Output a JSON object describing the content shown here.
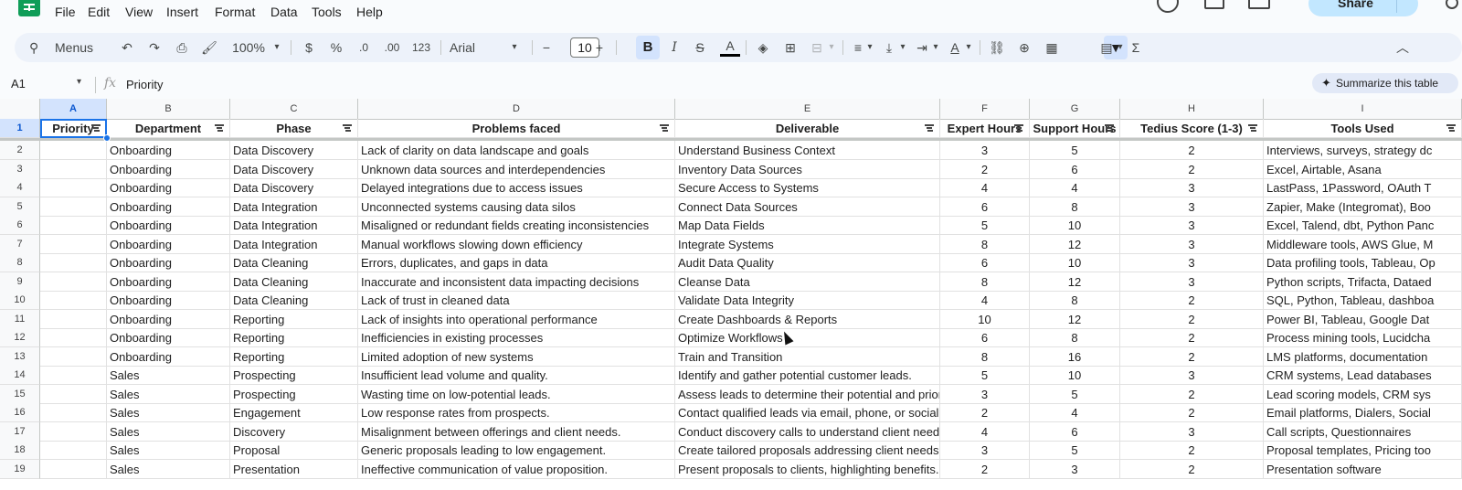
{
  "menubar": {
    "items": [
      "File",
      "Edit",
      "View",
      "Insert",
      "Format",
      "Data",
      "Tools",
      "Help"
    ],
    "share_label": "Share"
  },
  "toolbar": {
    "menus_label": "Menus",
    "zoom": "100%",
    "currency": "$",
    "percent": "%",
    "dec_decrease": ".0",
    "dec_increase": ".00",
    "number_format": "123",
    "font": "Arial",
    "font_size": "10",
    "minus": "−",
    "plus": "+",
    "bold": "B",
    "italic": "I",
    "strike": "S",
    "text_color": "A",
    "sigma": "Σ"
  },
  "formula_bar": {
    "name_box": "A1",
    "fx": "fx",
    "value": "Priority",
    "summarize_label": "Summarize this table"
  },
  "columns": [
    "A",
    "B",
    "C",
    "D",
    "E",
    "F",
    "G",
    "H",
    "I"
  ],
  "header_row": {
    "row_number": "1",
    "cells": [
      "Priority",
      "Department",
      "Phase",
      "Problems faced",
      "Deliverable",
      "Expert Hours",
      "Support Hours",
      "Tedius Score (1-3)",
      "Tools Used"
    ]
  },
  "rows": [
    {
      "n": "2",
      "cells": [
        "",
        "Onboarding",
        "Data Discovery",
        "Lack of clarity on data landscape and goals",
        "Understand Business Context",
        "3",
        "5",
        "2",
        "Interviews, surveys, strategy dc"
      ]
    },
    {
      "n": "3",
      "cells": [
        "",
        "Onboarding",
        "Data Discovery",
        "Unknown data sources and interdependencies",
        "Inventory Data Sources",
        "2",
        "6",
        "2",
        "Excel, Airtable, Asana"
      ]
    },
    {
      "n": "4",
      "cells": [
        "",
        "Onboarding",
        "Data Discovery",
        "Delayed integrations due to access issues",
        "Secure Access to Systems",
        "4",
        "4",
        "3",
        "LastPass, 1Password, OAuth T"
      ]
    },
    {
      "n": "5",
      "cells": [
        "",
        "Onboarding",
        "Data Integration",
        "Unconnected systems causing data silos",
        "Connect Data Sources",
        "6",
        "8",
        "3",
        "Zapier, Make (Integromat), Boo"
      ]
    },
    {
      "n": "6",
      "cells": [
        "",
        "Onboarding",
        "Data Integration",
        "Misaligned or redundant fields creating inconsistencies",
        "Map Data Fields",
        "5",
        "10",
        "3",
        "Excel, Talend, dbt, Python Panc"
      ]
    },
    {
      "n": "7",
      "cells": [
        "",
        "Onboarding",
        "Data Integration",
        "Manual workflows slowing down efficiency",
        "Integrate Systems",
        "8",
        "12",
        "3",
        "Middleware tools, AWS Glue, M"
      ]
    },
    {
      "n": "8",
      "cells": [
        "",
        "Onboarding",
        "Data Cleaning",
        "Errors, duplicates, and gaps in data",
        "Audit Data Quality",
        "6",
        "10",
        "3",
        "Data profiling tools, Tableau, Op"
      ]
    },
    {
      "n": "9",
      "cells": [
        "",
        "Onboarding",
        "Data Cleaning",
        "Inaccurate and inconsistent data impacting decisions",
        "Cleanse Data",
        "8",
        "12",
        "3",
        "Python scripts, Trifacta, Dataed"
      ]
    },
    {
      "n": "10",
      "cells": [
        "",
        "Onboarding",
        "Data Cleaning",
        "Lack of trust in cleaned data",
        "Validate Data Integrity",
        "4",
        "8",
        "2",
        "SQL, Python, Tableau, dashboa"
      ]
    },
    {
      "n": "11",
      "cells": [
        "",
        "Onboarding",
        "Reporting",
        "Lack of insights into operational performance",
        "Create Dashboards & Reports",
        "10",
        "12",
        "2",
        "Power BI, Tableau, Google Dat"
      ]
    },
    {
      "n": "12",
      "cells": [
        "",
        "Onboarding",
        "Reporting",
        "Inefficiencies in existing processes",
        "Optimize Workflows",
        "6",
        "8",
        "2",
        "Process mining tools, Lucidcha"
      ]
    },
    {
      "n": "13",
      "cells": [
        "",
        "Onboarding",
        "Reporting",
        "Limited adoption of new systems",
        "Train and Transition",
        "8",
        "16",
        "2",
        "LMS platforms, documentation"
      ]
    },
    {
      "n": "14",
      "cells": [
        "",
        "Sales",
        "Prospecting",
        "Insufficient lead volume and quality.",
        "Identify and gather potential customer leads.",
        "5",
        "10",
        "3",
        "CRM systems, Lead databases"
      ]
    },
    {
      "n": "15",
      "cells": [
        "",
        "Sales",
        "Prospecting",
        "Wasting time on low-potential leads.",
        "Assess leads to determine their potential and prior",
        "3",
        "5",
        "2",
        "Lead scoring models, CRM sys"
      ]
    },
    {
      "n": "16",
      "cells": [
        "",
        "Sales",
        "Engagement",
        "Low response rates from prospects.",
        "Contact qualified leads via email, phone, or social",
        "2",
        "4",
        "2",
        "Email platforms, Dialers, Social"
      ]
    },
    {
      "n": "17",
      "cells": [
        "",
        "Sales",
        "Discovery",
        "Misalignment between offerings and client needs.",
        "Conduct discovery calls to understand client need",
        "4",
        "6",
        "3",
        "Call scripts, Questionnaires"
      ]
    },
    {
      "n": "18",
      "cells": [
        "",
        "Sales",
        "Proposal",
        "Generic proposals leading to low engagement.",
        "Create tailored proposals addressing client needs.",
        "3",
        "5",
        "2",
        "Proposal templates, Pricing too"
      ]
    },
    {
      "n": "19",
      "cells": [
        "",
        "Sales",
        "Presentation",
        "Ineffective communication of value proposition.",
        "Present proposals to clients, highlighting benefits.",
        "2",
        "3",
        "2",
        "Presentation software"
      ]
    }
  ]
}
